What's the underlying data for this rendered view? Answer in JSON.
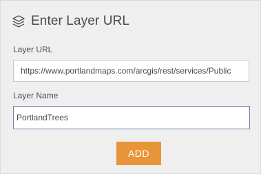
{
  "header": {
    "icon": "layers-icon",
    "title": "Enter Layer URL"
  },
  "fields": {
    "url": {
      "label": "Layer URL",
      "value": "https://www.portlandmaps.com/arcgis/rest/services/Public"
    },
    "name": {
      "label": "Layer Name",
      "value": "PortlandTrees"
    }
  },
  "actions": {
    "add_label": "ADD"
  },
  "colors": {
    "accent": "#e8953a",
    "panel_bg": "#efefef",
    "focus_border": "#6b7fa8"
  }
}
